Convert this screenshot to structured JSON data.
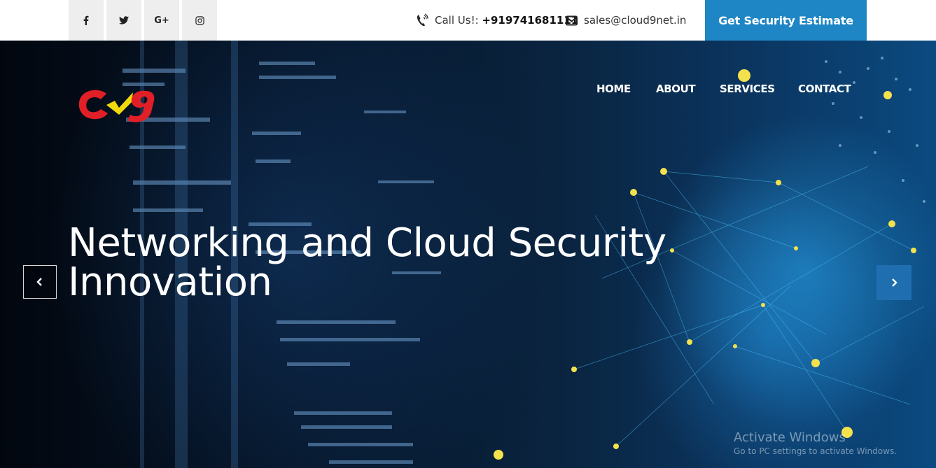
{
  "topbar": {
    "social": [
      {
        "name": "facebook-icon",
        "glyph": "f"
      },
      {
        "name": "twitter-icon",
        "glyph": "t"
      },
      {
        "name": "google-plus-icon",
        "glyph": "G+"
      },
      {
        "name": "instagram-icon",
        "glyph": "ig"
      }
    ],
    "call_label": "Call Us!:",
    "phone": "+919741681111",
    "email": "sales@cloud9net.in",
    "cta_label": "Get Security Estimate",
    "cta_color": "#1f86c5"
  },
  "nav": {
    "home": "HOME",
    "about": "ABOUT",
    "services": "SERVICES",
    "contact": "CONTACT"
  },
  "hero": {
    "headline_line1": "Networking and Cloud Security",
    "headline_line2": "Innovation"
  },
  "watermark": {
    "line1": "Activate Windows",
    "line2": "Go to PC settings to activate Windows."
  }
}
